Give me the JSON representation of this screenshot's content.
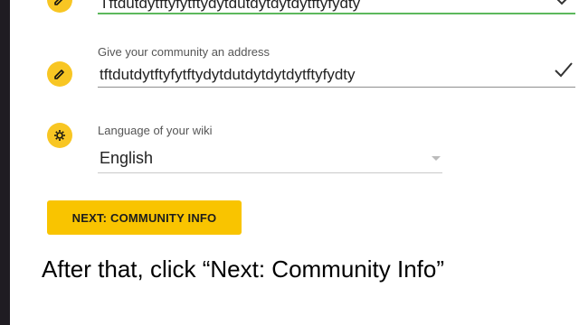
{
  "form": {
    "name_field": {
      "value": "Tftdutdytftyfytftydytdutdytdytdytftyfydty",
      "icon": "pencil-icon"
    },
    "address_field": {
      "label": "Give your community an address",
      "value": "tftdutdytftyfytftydytdutdytdytdytftyfydty",
      "icon": "pencil-icon"
    },
    "language_field": {
      "label": "Language of your wiki",
      "value": "English",
      "icon": "gear-icon"
    },
    "next_button": {
      "label": "NEXT: COMMUNITY INFO"
    }
  },
  "caption": {
    "text": "After that, click “Next: Community Info”"
  },
  "colors": {
    "accent": "#f9c400",
    "valid_underline": "#5cb85c",
    "sidebar": "#1f1c22"
  }
}
